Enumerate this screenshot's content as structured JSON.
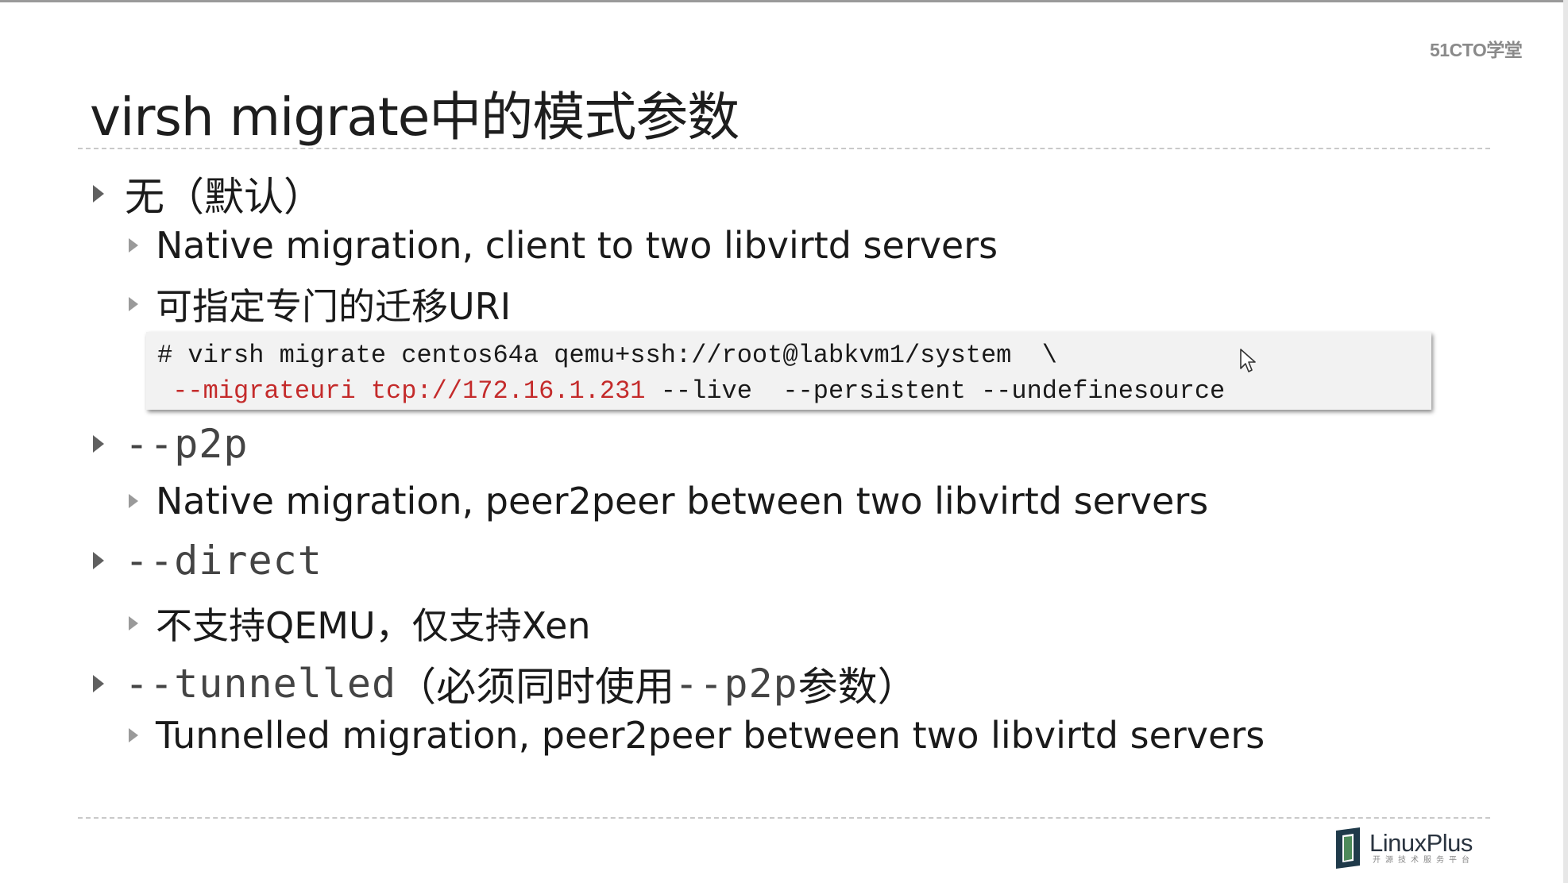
{
  "brand": "51CTO学堂",
  "title": "virsh migrate中的模式参数",
  "items": [
    {
      "label": "无（默认）",
      "subitems": [
        "Native migration, client to two libvirtd servers",
        "可指定专门的迁移URI"
      ],
      "code": {
        "line1": "# virsh migrate centos64a qemu+ssh://root@labkvm1/system  \\",
        "line2_red": " --migrateuri tcp://172.16.1.231",
        "line2_rest": " --live  --persistent --undefinesource"
      }
    },
    {
      "label": "--p2p",
      "subitems": [
        "Native migration, peer2peer between two libvirtd servers"
      ]
    },
    {
      "label": "--direct",
      "subitems": [
        "不支持QEMU，仅支持Xen"
      ]
    },
    {
      "label_mono": "--tunnelled",
      "label_open": "（必须同时使用",
      "label_mono2": "--p2p",
      "label_close": "参数）",
      "subitems": [
        "Tunnelled migration, peer2peer between two libvirtd servers"
      ]
    }
  ],
  "logo": {
    "name": "LinuxPlus",
    "tagline": "开源技术服务平台"
  },
  "colors": {
    "code_red": "#c42b2b",
    "code_bg": "#f2f2f2",
    "logo_dark": "#1f3a4a"
  }
}
